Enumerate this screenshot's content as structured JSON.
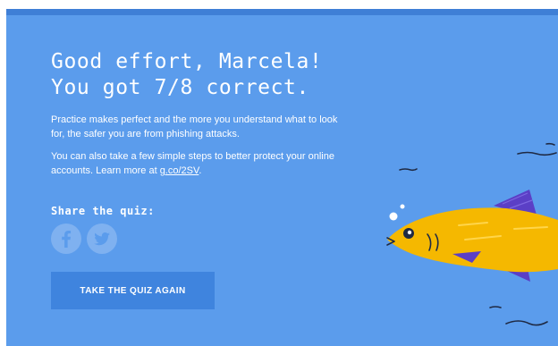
{
  "result": {
    "headline_line1": "Good effort, Marcela!",
    "headline_line2": "You got 7/8 correct.",
    "score_correct": 7,
    "score_total": 8
  },
  "body": {
    "paragraph1": "Practice makes perfect and the more you understand what to look for, the safer you are from phishing attacks.",
    "paragraph2_prefix": "You can also take a few simple steps to better protect your online accounts. Learn more at ",
    "paragraph2_link": "g.co/2SV",
    "paragraph2_suffix": "."
  },
  "share": {
    "label": "Share the quiz:",
    "icons": [
      "facebook-icon",
      "twitter-icon"
    ]
  },
  "actions": {
    "retake_label": "TAKE THE QUIZ AGAIN"
  },
  "theme": {
    "background": "#5b9cec",
    "top_bar": "#3f7fd6",
    "button": "#3f84de",
    "social_circle": "#7fb1f0",
    "fish_body": "#f5b800",
    "fish_fins": "#5b3fc6",
    "text": "#ffffff"
  }
}
